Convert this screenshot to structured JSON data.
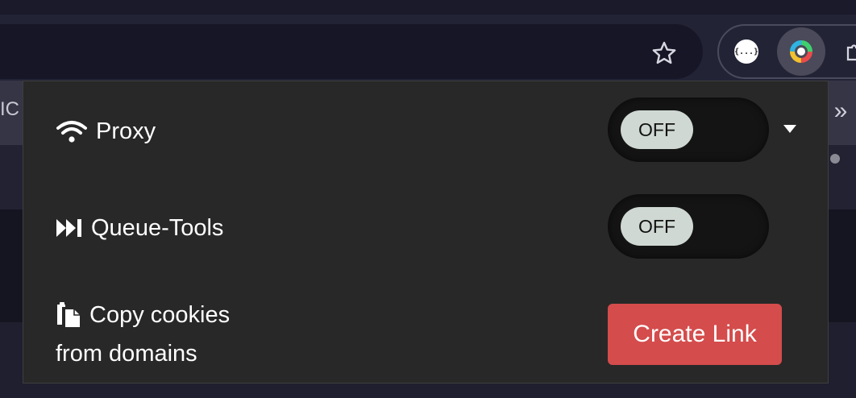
{
  "browser": {
    "bookmark_partial_label": "IC",
    "bookmarks_more_glyph": "»",
    "extensions": [
      {
        "name": "json-viewer-extension",
        "glyph": "{...}"
      },
      {
        "name": "proxy-extension",
        "active": true
      }
    ]
  },
  "popup": {
    "proxy": {
      "label": "Proxy",
      "icon": "wifi-icon",
      "toggle_text": "OFF",
      "has_dropdown": true
    },
    "queue_tools": {
      "label": "Queue-Tools",
      "icon": "fast-forward-icon",
      "toggle_text": "OFF"
    },
    "copy_cookies": {
      "label_line1": "Copy cookies",
      "label_line2": "from domains",
      "icon": "copy-files-icon",
      "button_label": "Create Link"
    }
  },
  "colors": {
    "popup_bg": "#282828",
    "toggle_track": "#141414",
    "toggle_knob": "#cfd8d2",
    "create_link_button": "#d44c4c"
  }
}
